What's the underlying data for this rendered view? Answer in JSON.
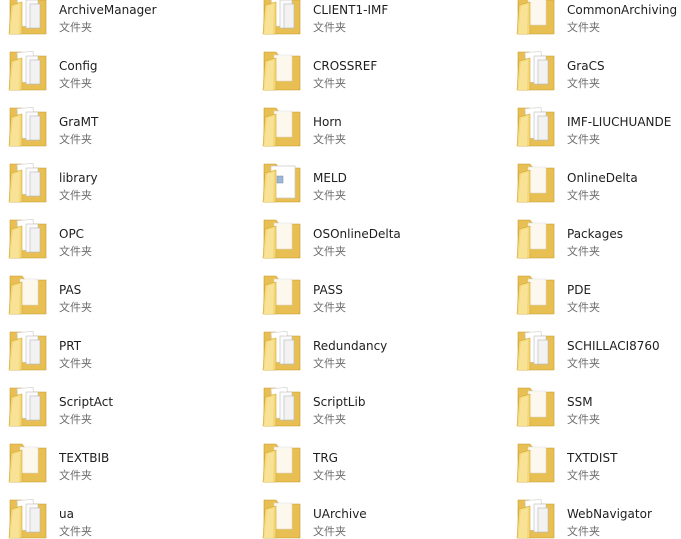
{
  "items": [
    {
      "name": "ArchiveManager",
      "type": "文件夹",
      "icon": "folder-docs"
    },
    {
      "name": "CLIENT1-IMF",
      "type": "文件夹",
      "icon": "folder-docs"
    },
    {
      "name": "CommonArchiving",
      "type": "文件夹",
      "icon": "folder"
    },
    {
      "name": "Config",
      "type": "文件夹",
      "icon": "folder-docs"
    },
    {
      "name": "CROSSREF",
      "type": "文件夹",
      "icon": "folder"
    },
    {
      "name": "GraCS",
      "type": "文件夹",
      "icon": "folder-docs"
    },
    {
      "name": "GraMT",
      "type": "文件夹",
      "icon": "folder-docs"
    },
    {
      "name": "Horn",
      "type": "文件夹",
      "icon": "folder"
    },
    {
      "name": "IMF-LIUCHUANDE",
      "type": "文件夹",
      "icon": "folder-docs"
    },
    {
      "name": "library",
      "type": "文件夹",
      "icon": "folder-docs"
    },
    {
      "name": "MELD",
      "type": "文件夹",
      "icon": "folder-file"
    },
    {
      "name": "OnlineDelta",
      "type": "文件夹",
      "icon": "folder"
    },
    {
      "name": "OPC",
      "type": "文件夹",
      "icon": "folder-docs"
    },
    {
      "name": "OSOnlineDelta",
      "type": "文件夹",
      "icon": "folder"
    },
    {
      "name": "Packages",
      "type": "文件夹",
      "icon": "folder"
    },
    {
      "name": "PAS",
      "type": "文件夹",
      "icon": "folder"
    },
    {
      "name": "PASS",
      "type": "文件夹",
      "icon": "folder"
    },
    {
      "name": "PDE",
      "type": "文件夹",
      "icon": "folder"
    },
    {
      "name": "PRT",
      "type": "文件夹",
      "icon": "folder-docs"
    },
    {
      "name": "Redundancy",
      "type": "文件夹",
      "icon": "folder-docs"
    },
    {
      "name": "SCHILLACI8760",
      "type": "文件夹",
      "icon": "folder-docs"
    },
    {
      "name": "ScriptAct",
      "type": "文件夹",
      "icon": "folder-docs"
    },
    {
      "name": "ScriptLib",
      "type": "文件夹",
      "icon": "folder-docs"
    },
    {
      "name": "SSM",
      "type": "文件夹",
      "icon": "folder"
    },
    {
      "name": "TEXTBIB",
      "type": "文件夹",
      "icon": "folder"
    },
    {
      "name": "TRG",
      "type": "文件夹",
      "icon": "folder"
    },
    {
      "name": "TXTDIST",
      "type": "文件夹",
      "icon": "folder"
    },
    {
      "name": "ua",
      "type": "文件夹",
      "icon": "folder-docs"
    },
    {
      "name": "UArchive",
      "type": "文件夹",
      "icon": "folder"
    },
    {
      "name": "WebNavigator",
      "type": "文件夹",
      "icon": "folder-docs"
    }
  ],
  "colors": {
    "folder_back": "#e6bc4e",
    "folder_front": "#f7df8c",
    "paper": "#ffffff",
    "text": "#1e1e1e",
    "subtext": "#6d6d6d"
  }
}
